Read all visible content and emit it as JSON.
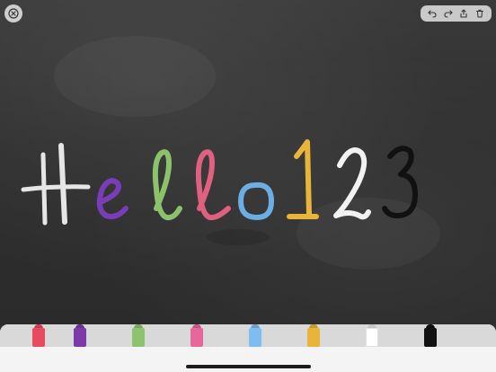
{
  "icons": {
    "close": "close-circle-icon",
    "undo": "undo-icon",
    "redo": "redo-icon",
    "share": "share-icon",
    "trash": "trash-icon"
  },
  "drawing": {
    "characters": [
      {
        "char": "H",
        "color": "#e6e6e6"
      },
      {
        "char": "e",
        "color": "#7a3db8"
      },
      {
        "char": "l",
        "color": "#8cc26a"
      },
      {
        "char": "l",
        "color": "#e0607f"
      },
      {
        "char": "o",
        "color": "#6aaee3"
      },
      {
        "char": "1",
        "color": "#e9b43a"
      },
      {
        "char": "2",
        "color": "#f2f2f2"
      },
      {
        "char": "3",
        "color": "#111111"
      }
    ]
  },
  "chalks": [
    {
      "color": "#e84a5f",
      "name": "red"
    },
    {
      "color": "#7b3aa8",
      "name": "purple"
    },
    {
      "color": "#8bc46c",
      "name": "green"
    },
    {
      "color": "#e6679a",
      "name": "pink"
    },
    {
      "color": "#7dbdf0",
      "name": "blue"
    },
    {
      "color": "#e9b43a",
      "name": "yellow"
    },
    {
      "color": "#ffffff",
      "name": "white"
    },
    {
      "color": "#111111",
      "name": "black"
    }
  ]
}
